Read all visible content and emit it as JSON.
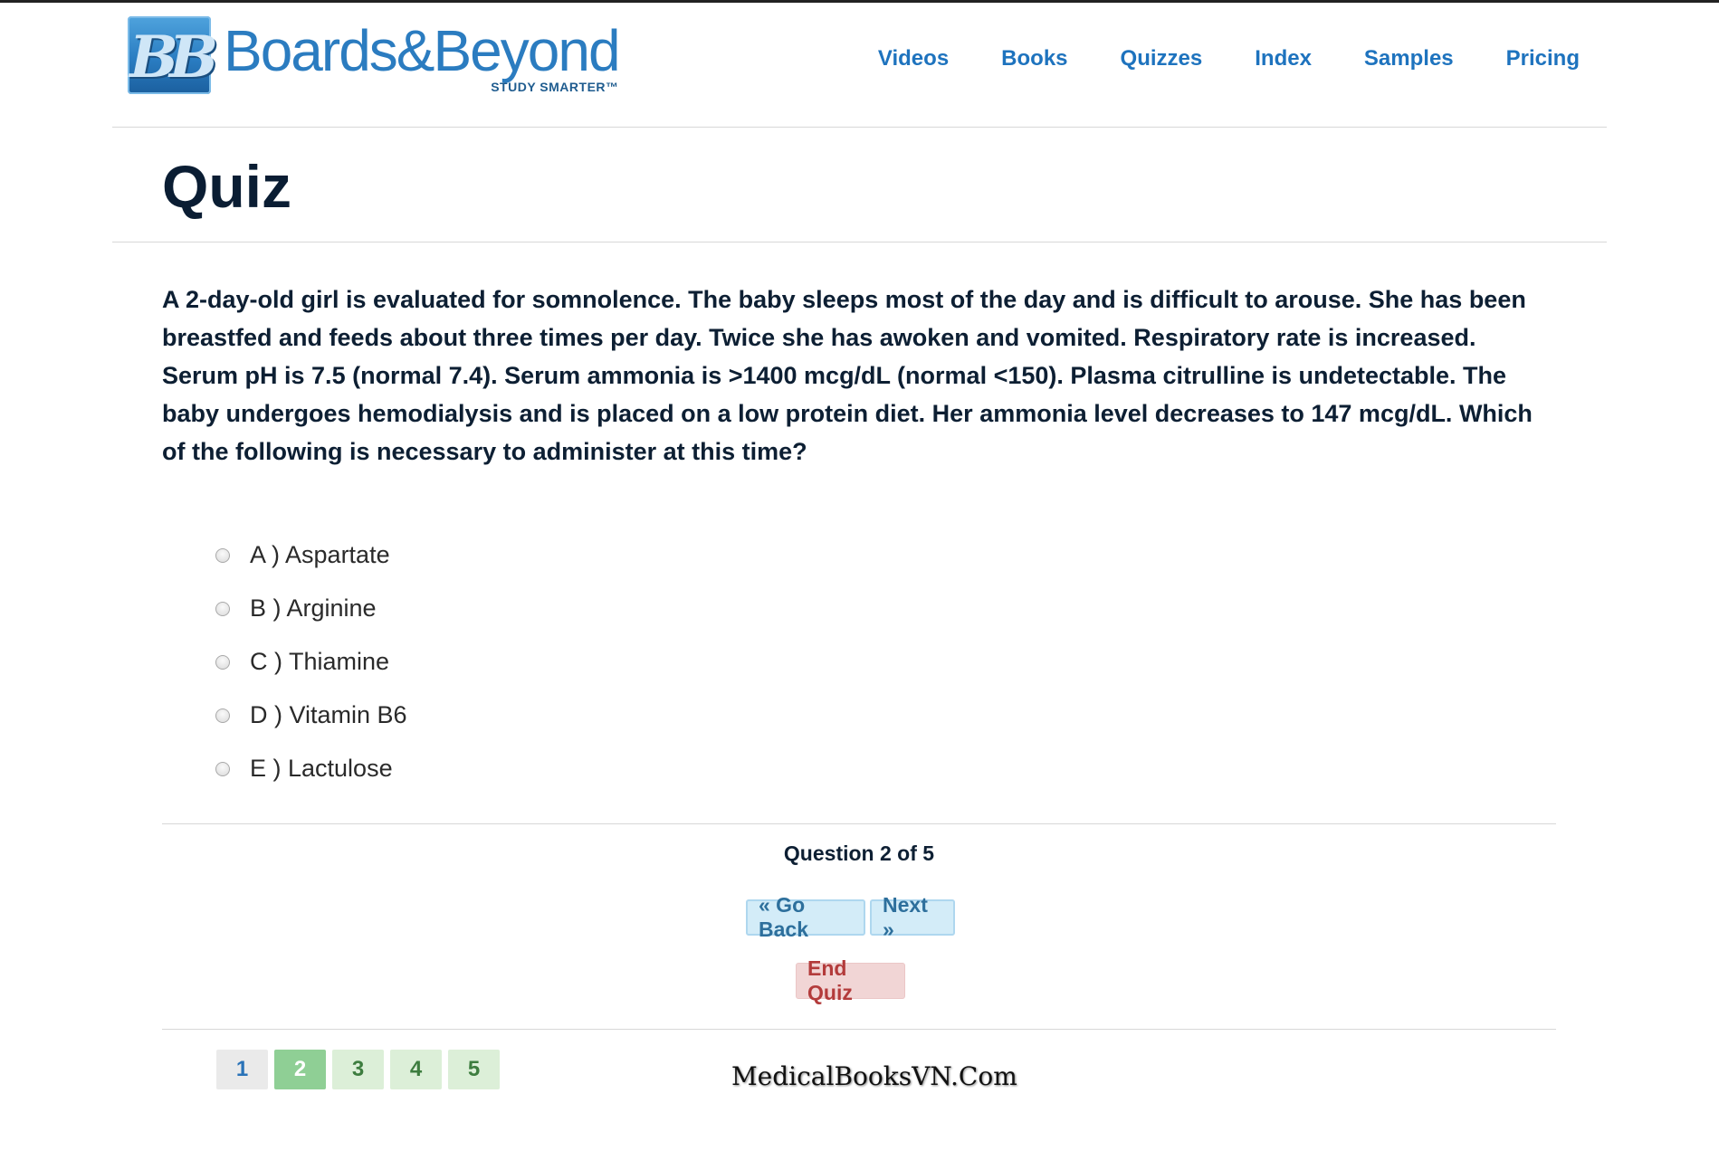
{
  "brand": {
    "logo_mark": "BB",
    "name": "Boards&Beyond",
    "tagline": "STUDY SMARTER™"
  },
  "nav": {
    "items": [
      "Videos",
      "Books",
      "Quizzes",
      "Index",
      "Samples",
      "Pricing"
    ]
  },
  "page": {
    "title": "Quiz"
  },
  "question": {
    "text": "A 2-day-old girl is evaluated for somnolence. The baby sleeps most of the day and is difficult to arouse. She has been breastfed and feeds about three times per day. Twice she has awoken and vomited. Respiratory rate is increased. Serum pH is 7.5 (normal 7.4). Serum ammonia is >1400 mcg/dL (normal <150). Plasma citrulline is undetectable. The baby undergoes hemodialysis and is placed on a low protein diet. Her ammonia level decreases to 147 mcg/dL. Which of the following is necessary to administer at this time?",
    "options": [
      "A ) Aspartate",
      "B ) Arginine",
      "C ) Thiamine",
      "D ) Vitamin B6",
      "E ) Lactulose"
    ]
  },
  "progress": {
    "label": "Question 2 of 5"
  },
  "controls": {
    "back_label": "« Go Back",
    "next_label": "Next »",
    "end_label": "End Quiz"
  },
  "pager": {
    "pages": [
      "1",
      "2",
      "3",
      "4",
      "5"
    ]
  },
  "watermark": "MedicalBooksVN.Com",
  "colors": {
    "brand_blue": "#2b7cc0",
    "nav_link": "#1e73be",
    "end_quiz": "#b33b3b",
    "pager_active": "#8fcf95"
  }
}
